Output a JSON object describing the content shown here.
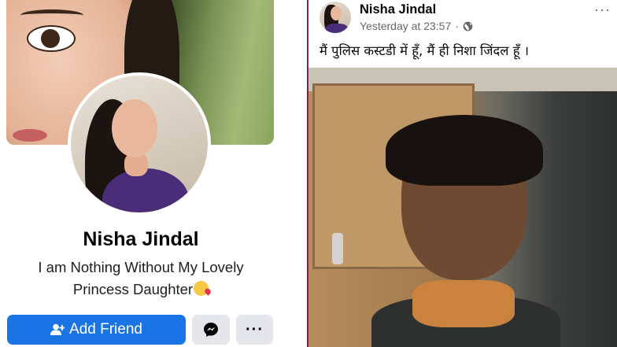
{
  "profile": {
    "name": "Nisha Jindal",
    "bio_line1": "I am Nothing Without My Lovely",
    "bio_line2": "Princess Daughter",
    "add_friend_label": "Add Friend",
    "more_label": "···"
  },
  "post": {
    "author": "Nisha Jindal",
    "time": "Yesterday at 23:57",
    "separator": "·",
    "more_label": "···",
    "caption": "मैं पुलिस कस्टडी में हूँ, मैं ही निशा जिंदल हूँ ।"
  },
  "colors": {
    "add_friend": "#1b74e4",
    "secondary_button": "#e4e6eb",
    "divider": "#8b1a5a"
  },
  "icons": {
    "add_friend": "person-plus-icon",
    "messenger": "messenger-icon",
    "privacy": "globe-icon",
    "emoji": "kissing-face-emoji"
  }
}
